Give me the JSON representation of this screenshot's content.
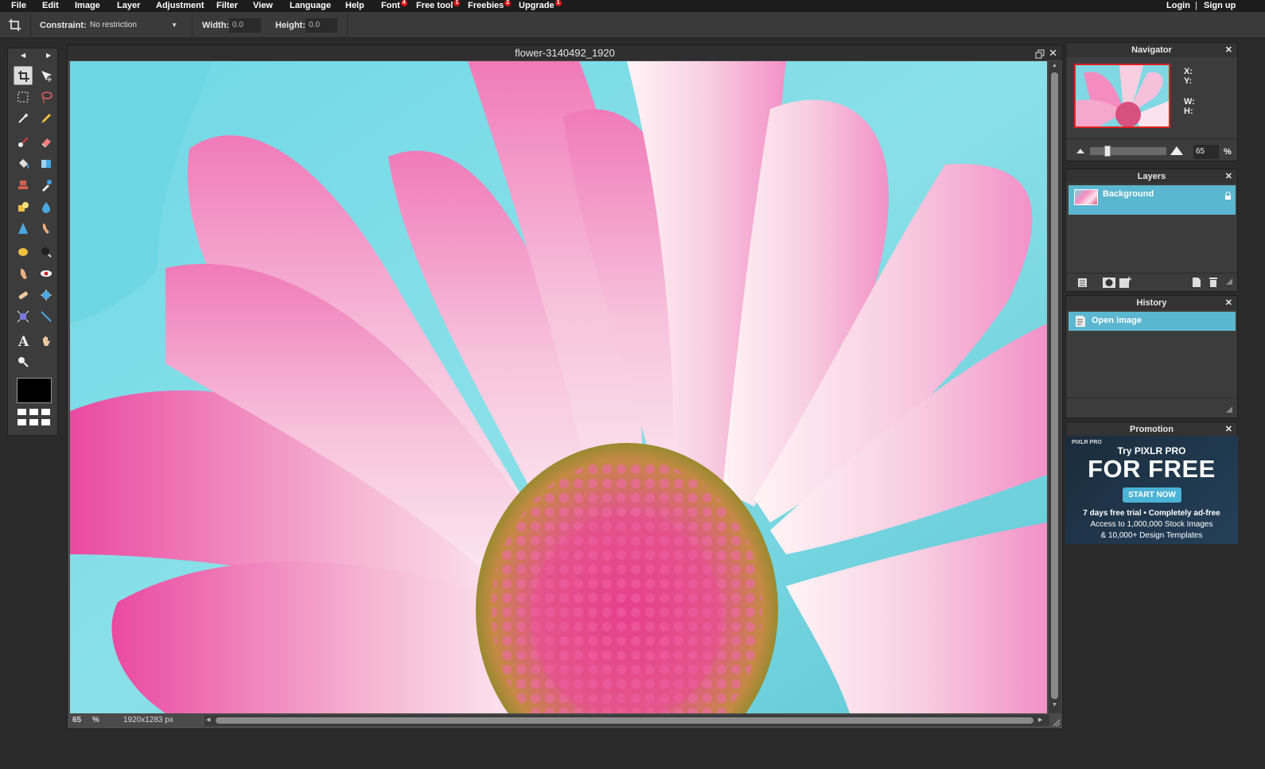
{
  "menu": {
    "items": [
      {
        "label": "File",
        "badge": ""
      },
      {
        "label": "Edit",
        "badge": ""
      },
      {
        "label": "Image",
        "badge": ""
      },
      {
        "label": "Layer",
        "badge": ""
      },
      {
        "label": "Adjustment",
        "badge": ""
      },
      {
        "label": "Filter",
        "badge": ""
      },
      {
        "label": "View",
        "badge": ""
      },
      {
        "label": "Language",
        "badge": ""
      },
      {
        "label": "Help",
        "badge": ""
      },
      {
        "label": "Font",
        "badge": "4"
      },
      {
        "label": "Free tool",
        "badge": "1"
      },
      {
        "label": "Freebies",
        "badge": "2"
      },
      {
        "label": "Upgrade",
        "badge": "1"
      }
    ],
    "login": "Login",
    "separator": "|",
    "signup": "Sign up"
  },
  "options": {
    "constraint_label": "Constraint:",
    "constraint_value": "No restriction",
    "width_label": "Width:",
    "width_value": "0.0",
    "height_label": "Height:",
    "height_value": "0.0"
  },
  "tools": {
    "icons": [
      "crop-icon",
      "move-icon",
      "marquee-icon",
      "lasso-icon",
      "wand-icon",
      "pencil-icon",
      "brush-icon",
      "eraser-icon",
      "bucket-icon",
      "gradient-icon",
      "stamp-icon",
      "color-picker-icon",
      "shape-icon",
      "blur-icon",
      "sharpen-icon",
      "smudge-icon",
      "sponge-icon",
      "burn-icon",
      "dodge-icon",
      "red-eye-icon",
      "spot-heal-icon",
      "bloat-icon",
      "pinch-icon",
      "line-icon",
      "text-icon",
      "hand-icon",
      "zoom-icon"
    ],
    "foreground_color": "#000000"
  },
  "canvas": {
    "title": "flower-3140492_1920",
    "zoom": "65",
    "zoom_unit": "%",
    "dimensions": "1920x1283 px"
  },
  "navigator": {
    "title": "Navigator",
    "x_label": "X:",
    "y_label": "Y:",
    "w_label": "W:",
    "h_label": "H:",
    "zoom_value": "65",
    "zoom_unit": "%",
    "zoom_level": 0.2
  },
  "layers": {
    "title": "Layers",
    "items": [
      {
        "name": "Background",
        "locked": true
      }
    ]
  },
  "history": {
    "title": "History",
    "items": [
      {
        "label": "Open image"
      }
    ]
  },
  "promotion": {
    "title": "Promotion",
    "brand": "PIXLR PRO",
    "line1": "Try PIXLR PRO",
    "headline": "FOR FREE",
    "cta": "START NOW",
    "detail1": "7 days free trial  •  Completely ad-free",
    "detail2": "Access to 1,000,000 Stock Images",
    "detail3": "& 10,000+ Design Templates"
  },
  "colors": {
    "accent": "#5bb6cf",
    "badge": "#e01010",
    "menubar": "#1c1c1c"
  }
}
